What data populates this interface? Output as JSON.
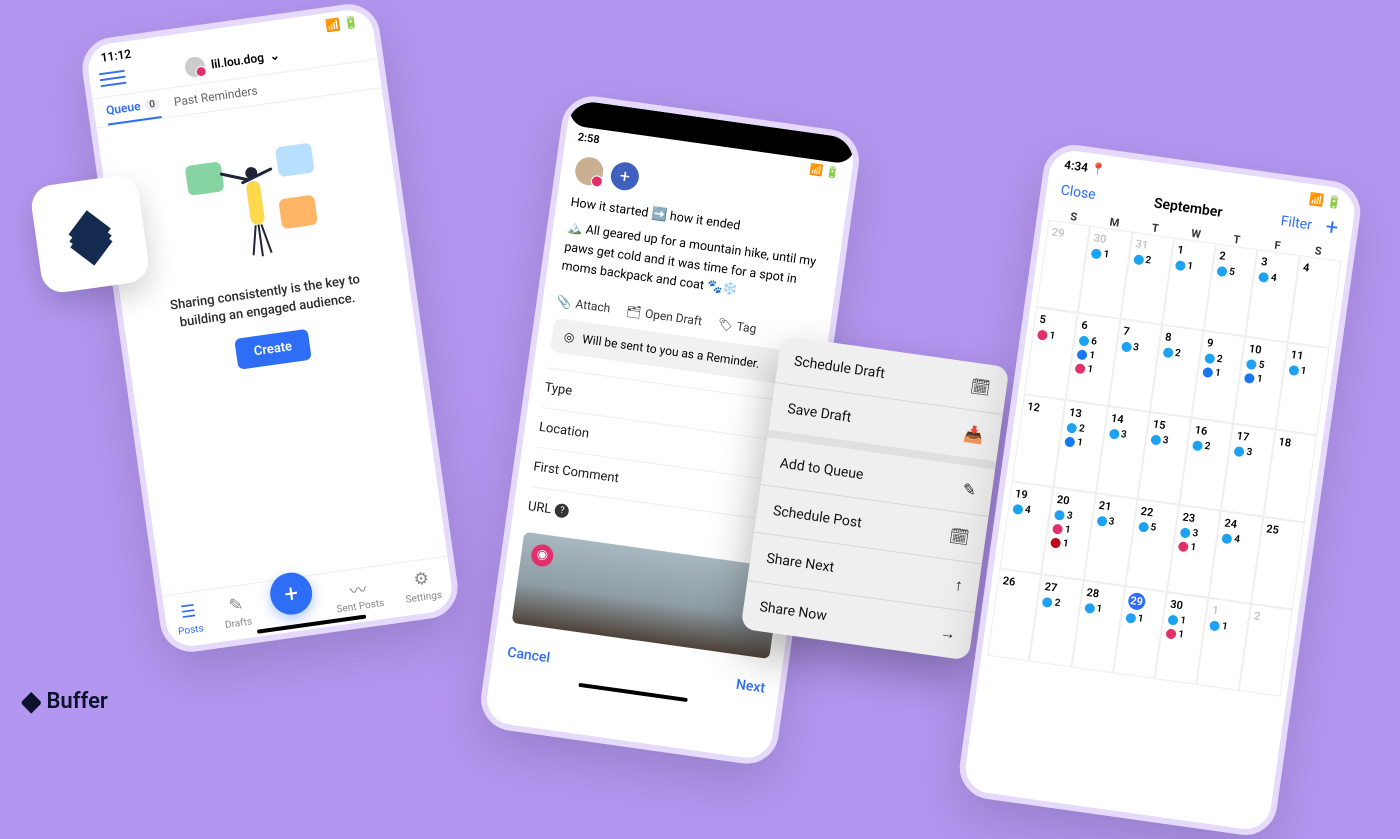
{
  "brand": "Buffer",
  "phone1": {
    "time": "11:12",
    "account": "lil.lou.dog",
    "tabs": {
      "queue": "Queue",
      "queue_count": "0",
      "past": "Past Reminders"
    },
    "empty_message": "Sharing consistently is the key to building an engaged audience.",
    "create_label": "Create",
    "nav": {
      "posts": "Posts",
      "drafts": "Drafts",
      "sent": "Sent Posts",
      "settings": "Settings"
    }
  },
  "phone2": {
    "time": "2:58",
    "line1": "How it started ➡️ how it ended",
    "line2": "🏔️ All geared up for a mountain hike, until my paws get cold and it was time for a spot in moms backpack and coat 🐾❄️",
    "tools": {
      "attach": "Attach",
      "open_draft": "Open Draft",
      "tag": "Tag"
    },
    "reminder": "Will be sent to you as a Reminder.",
    "fields": {
      "type": "Type",
      "location": "Location",
      "first_comment": "First Comment",
      "url": "URL"
    },
    "cancel": "Cancel",
    "next": "Next"
  },
  "sheet": {
    "schedule_draft": "Schedule Draft",
    "save_draft": "Save Draft",
    "add_to_queue": "Add to Queue",
    "schedule_post": "Schedule Post",
    "share_next": "Share Next",
    "share_now": "Share Now"
  },
  "phone3": {
    "time": "4:34",
    "close": "Close",
    "month": "September",
    "filter": "Filter",
    "dow": [
      "S",
      "M",
      "T",
      "W",
      "T",
      "F",
      "S"
    ],
    "cells": [
      {
        "n": "29",
        "out": true,
        "ev": []
      },
      {
        "n": "30",
        "out": true,
        "ev": [
          [
            "tw",
            "1"
          ]
        ]
      },
      {
        "n": "31",
        "out": true,
        "ev": [
          [
            "tw",
            "2"
          ]
        ]
      },
      {
        "n": "1",
        "ev": [
          [
            "tw",
            "1"
          ]
        ]
      },
      {
        "n": "2",
        "ev": [
          [
            "tw",
            "5"
          ]
        ]
      },
      {
        "n": "3",
        "ev": [
          [
            "tw",
            "4"
          ]
        ]
      },
      {
        "n": "4",
        "ev": []
      },
      {
        "n": "5",
        "ev": [
          [
            "ig",
            "1"
          ]
        ]
      },
      {
        "n": "6",
        "ev": [
          [
            "tw",
            "6"
          ],
          [
            "fb",
            "1"
          ],
          [
            "ig",
            "1"
          ]
        ]
      },
      {
        "n": "7",
        "ev": [
          [
            "tw",
            "3"
          ]
        ]
      },
      {
        "n": "8",
        "ev": [
          [
            "tw",
            "2"
          ]
        ]
      },
      {
        "n": "9",
        "ev": [
          [
            "tw",
            "2"
          ],
          [
            "fb",
            "1"
          ]
        ]
      },
      {
        "n": "10",
        "ev": [
          [
            "tw",
            "5"
          ],
          [
            "fb",
            "1"
          ]
        ]
      },
      {
        "n": "11",
        "ev": [
          [
            "tw",
            "1"
          ]
        ]
      },
      {
        "n": "12",
        "ev": []
      },
      {
        "n": "13",
        "ev": [
          [
            "tw",
            "2"
          ],
          [
            "fb",
            "1"
          ]
        ]
      },
      {
        "n": "14",
        "ev": [
          [
            "tw",
            "3"
          ]
        ]
      },
      {
        "n": "15",
        "ev": [
          [
            "tw",
            "3"
          ]
        ]
      },
      {
        "n": "16",
        "ev": [
          [
            "tw",
            "2"
          ]
        ]
      },
      {
        "n": "17",
        "ev": [
          [
            "tw",
            "3"
          ]
        ]
      },
      {
        "n": "18",
        "ev": []
      },
      {
        "n": "19",
        "ev": [
          [
            "tw",
            "4"
          ]
        ]
      },
      {
        "n": "20",
        "ev": [
          [
            "tw",
            "3"
          ],
          [
            "ig",
            "1"
          ],
          [
            "pi",
            "1"
          ]
        ]
      },
      {
        "n": "21",
        "ev": [
          [
            "tw",
            "3"
          ]
        ]
      },
      {
        "n": "22",
        "ev": [
          [
            "tw",
            "5"
          ]
        ]
      },
      {
        "n": "23",
        "ev": [
          [
            "tw",
            "3"
          ],
          [
            "ig",
            "1"
          ]
        ]
      },
      {
        "n": "24",
        "ev": [
          [
            "tw",
            "4"
          ]
        ]
      },
      {
        "n": "25",
        "ev": []
      },
      {
        "n": "26",
        "ev": []
      },
      {
        "n": "27",
        "ev": [
          [
            "tw",
            "2"
          ]
        ]
      },
      {
        "n": "28",
        "ev": [
          [
            "tw",
            "1"
          ]
        ]
      },
      {
        "n": "29",
        "today": true,
        "ev": [
          [
            "tw",
            "1"
          ]
        ]
      },
      {
        "n": "30",
        "ev": [
          [
            "tw",
            "1"
          ],
          [
            "ig",
            "1"
          ]
        ]
      },
      {
        "n": "1",
        "out": true,
        "ev": [
          [
            "tw",
            "1"
          ]
        ]
      },
      {
        "n": "2",
        "out": true,
        "ev": []
      }
    ]
  }
}
